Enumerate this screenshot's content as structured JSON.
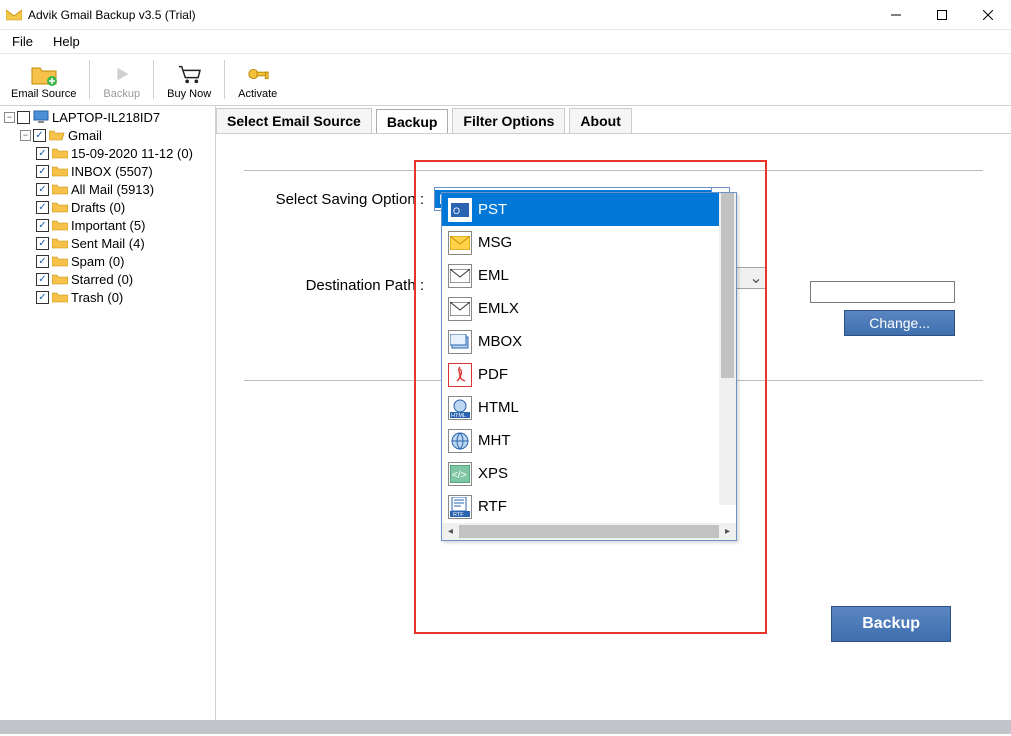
{
  "titlebar": {
    "title": "Advik Gmail Backup v3.5 (Trial)"
  },
  "menu": {
    "file": "File",
    "help": "Help"
  },
  "toolbar": {
    "email_source": "Email Source",
    "backup": "Backup",
    "buy_now": "Buy Now",
    "activate": "Activate"
  },
  "tree": {
    "root": "LAPTOP-IL218ID7",
    "gmail": "Gmail",
    "folders": [
      "15-09-2020 11-12 (0)",
      "INBOX (5507)",
      "All Mail (5913)",
      "Drafts (0)",
      "Important (5)",
      "Sent Mail (4)",
      "Spam (0)",
      "Starred (0)",
      "Trash (0)"
    ]
  },
  "tabs": {
    "select_source": "Select Email Source",
    "backup": "Backup",
    "filter": "Filter Options",
    "about": "About"
  },
  "form": {
    "saving_label": "Select Saving Option  :",
    "saving_value": "PST",
    "dest_label": "Destination Path  :",
    "dest_value": "",
    "change": "Change...",
    "backup_btn": "Backup"
  },
  "dropdown": {
    "items": [
      "PST",
      "MSG",
      "EML",
      "EMLX",
      "MBOX",
      "PDF",
      "HTML",
      "MHT",
      "XPS",
      "RTF"
    ]
  }
}
